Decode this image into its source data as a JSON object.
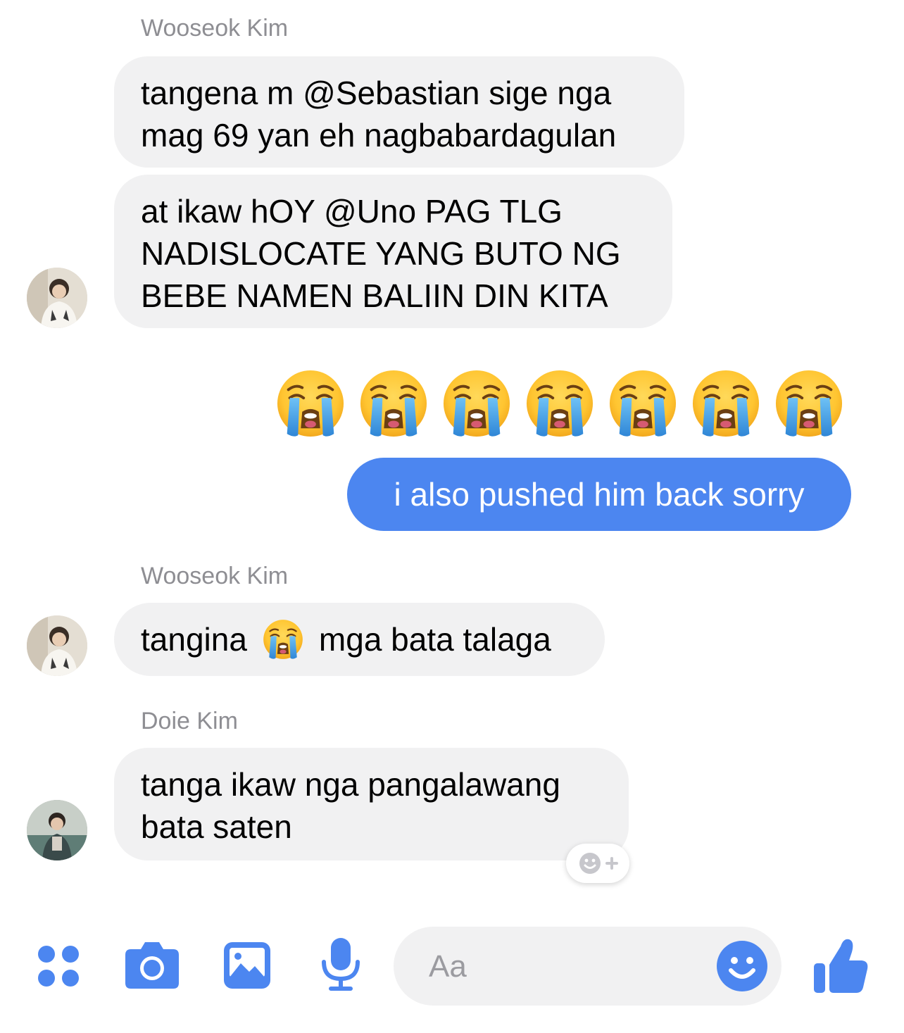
{
  "colors": {
    "accent": "#4c86f0",
    "received_bubble": "#f1f1f2",
    "sender_name": "#8e8e93"
  },
  "messages": [
    {
      "sender": "Wooseok Kim",
      "bubbles": [
        [
          "tangena m @Sebastian sige nga",
          "mag 69 yan eh nagbabardagulan"
        ],
        [
          "at ikaw hOY @Uno PAG TLG",
          "NADISLOCATE YANG BUTO NG",
          "BEBE NAMEN BALIIN DIN KITA"
        ]
      ]
    },
    {
      "sent_emoji_icon": "loudly-crying-face-emoji",
      "sent_emoji_count": 7,
      "sent_text": "i also pushed him back sorry"
    },
    {
      "sender": "Wooseok Kim",
      "text_before": "tangina",
      "inline_icon": "loudly-crying-face-emoji",
      "text_after": "mga bata talaga"
    },
    {
      "sender": "Doie Kim",
      "bubbles": [
        [
          "tanga ikaw nga pangalawang",
          "bata saten"
        ]
      ]
    }
  ],
  "composer": {
    "placeholder": "Aa"
  },
  "toolbar": {
    "icons": [
      "more-apps-icon",
      "camera-icon",
      "gallery-icon",
      "microphone-icon",
      "emoji-icon",
      "thumbs-up-icon"
    ]
  }
}
